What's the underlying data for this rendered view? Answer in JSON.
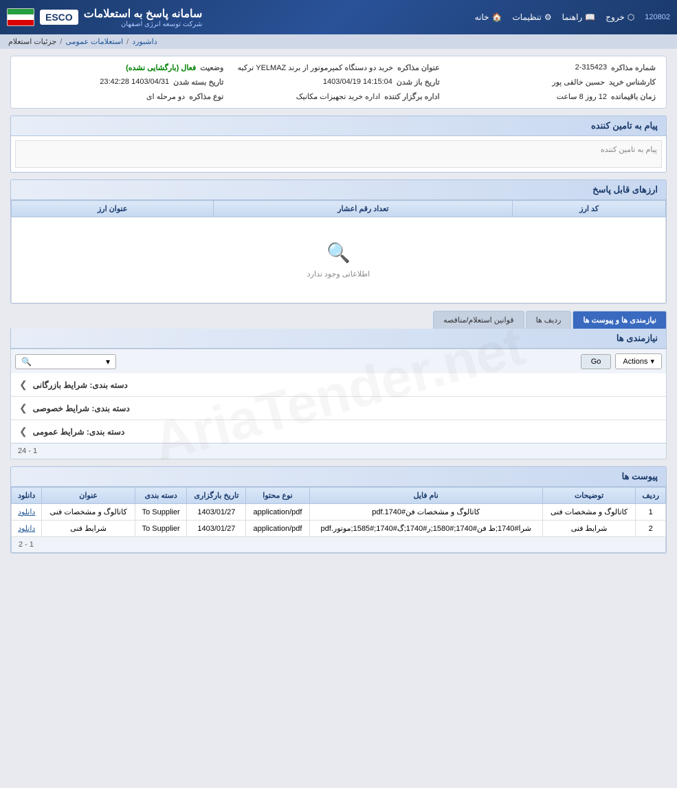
{
  "topNav": {
    "title": "سامانه پاسخ به استعلامات",
    "userId": "120802",
    "navItems": [
      {
        "label": "خانه",
        "icon": "home"
      },
      {
        "label": "تنظیمات",
        "icon": "gear"
      },
      {
        "label": "راهنما",
        "icon": "book"
      },
      {
        "label": "خروج",
        "icon": "exit"
      }
    ],
    "escoBrand": "ESCO",
    "subBrand": "شرکت توسعه انرژی اصفهان"
  },
  "breadcrumb": {
    "items": [
      "داشبورد",
      "استعلامات عمومی",
      "جزئیات استعلام"
    ]
  },
  "detail": {
    "negotiationNumber": "2-315423",
    "negotiationTitle": "خرید دو دستگاه کمپرموتور از برند YELMAZ ترکیه",
    "status": "فعال (بارگشایی نشده)",
    "openDate": "14:15:04\n1403/04/19",
    "closeDate": "1403/04/31 23:42:28",
    "purchaseExpert": "حسین خالقی پور",
    "organizerOffice": "اداره خرید تجهیزات مکانیک",
    "remainingTime": "12 روز 8 ساعت",
    "negotiationType": "دو مرحله ای"
  },
  "messageSection": {
    "title": "پیام به تامین کننده",
    "placeholder": "پیام به تامین کننده"
  },
  "currencySection": {
    "title": "ارزهای قابل پاسخ",
    "columns": [
      "کد ارز",
      "تعداد رقم اعشار",
      "عنوان ارز"
    ],
    "emptyMessage": "اطلاعاتی وجود ندارد"
  },
  "tabs": [
    {
      "label": "نیازمندی ها و پیوست ها",
      "active": true
    },
    {
      "label": "ردیف ها",
      "active": false
    },
    {
      "label": "قوانین استعلام/مناقصه",
      "active": false
    }
  ],
  "requirementsSection": {
    "sectionTitle": "نیازمندی ها",
    "toolbar": {
      "actionsLabel": "Actions",
      "goLabel": "Go"
    },
    "categories": [
      {
        "label": "دسته بندی: شرایط بازرگانی"
      },
      {
        "label": "دسته بندی: شرایط خصوصی"
      },
      {
        "label": "دسته بندی: شرایط عمومی"
      }
    ],
    "pagination": "1 - 24"
  },
  "attachmentsSection": {
    "title": "پیوست ها",
    "columns": [
      "ردیف",
      "توضیحات",
      "نام فایل",
      "نوع محتوا",
      "تاریخ بارگزاری",
      "دسته بندی",
      "عنوان",
      "دانلود"
    ],
    "rows": [
      {
        "index": "1",
        "description": "کاتالوگ و مشخصات فنی",
        "fileName": "کاتالوگ و مشخصات فن#1740.pdf",
        "contentType": "application/pdf",
        "uploadDate": "1403/01/27",
        "category": "To Supplier",
        "title": "کاتالوگ و مشخصات فنی",
        "downloadLabel": "دانلود"
      },
      {
        "index": "2",
        "description": "شرایط فنی",
        "fileName": "شرا#1740;ط فن#1740;#1580;ر#1740;گ#1740;#1585;موتور.pdf",
        "contentType": "application/pdf",
        "uploadDate": "1403/01/27",
        "category": "To Supplier",
        "title": "شرایط فنی",
        "downloadLabel": "دانلود"
      }
    ],
    "pagination": "1 - 2"
  }
}
